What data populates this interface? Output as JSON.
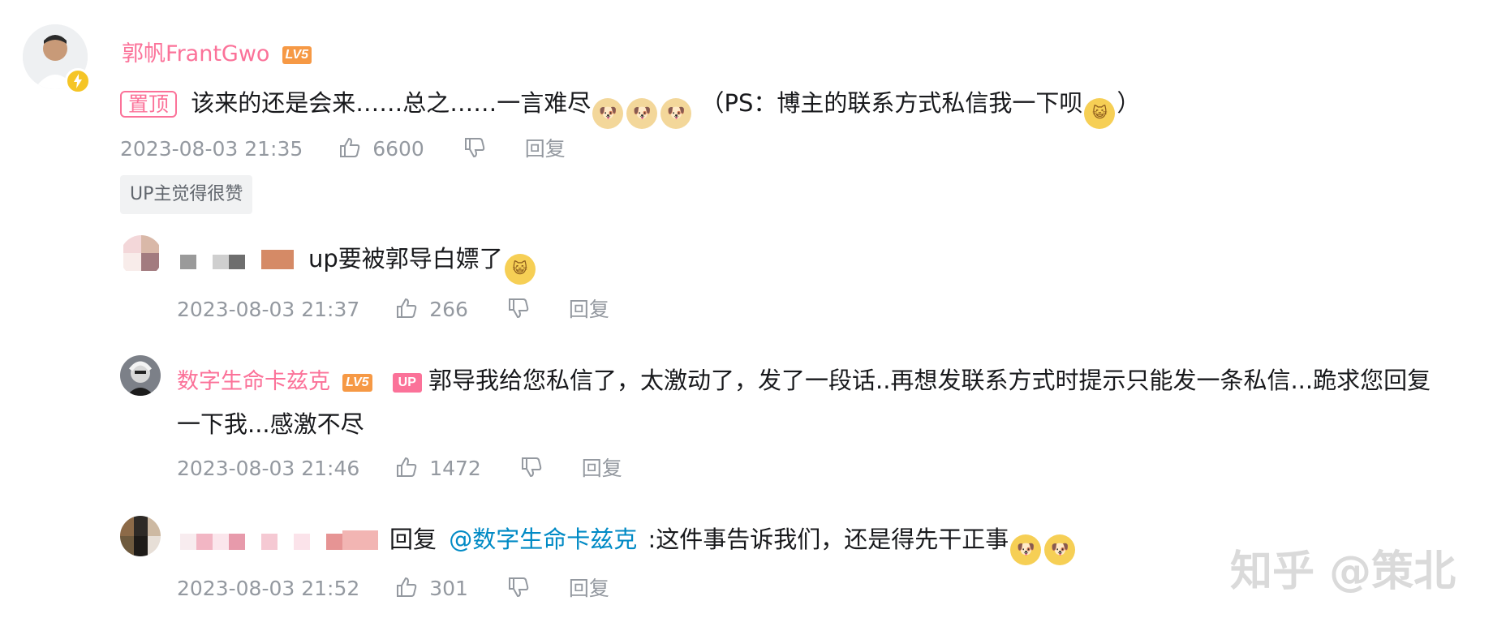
{
  "comments": [
    {
      "username": "郭帆FrantGwo",
      "level": "LV5",
      "pinned_label": "置顶",
      "text_before": "该来的还是会来……总之……一言难尽",
      "text_after": "（PS：博主的联系方式私信我一下呗",
      "text_end": "）",
      "time": "2023-08-03 21:35",
      "likes": "6600",
      "reply_label": "回复",
      "up_liked_label": "UP主觉得很赞"
    }
  ],
  "replies": [
    {
      "username": "",
      "text": "up要被郭导白嫖了",
      "time": "2023-08-03 21:37",
      "likes": "266",
      "reply_label": "回复"
    },
    {
      "username": "数字生命卡兹克",
      "level": "LV5",
      "up_badge": "UP",
      "text_line1": "郭导我给您私信了，太激动了，发了一段话..再想发联系方式时提示只能发一条私信...跪求您回复",
      "text_line2": "一下我...感激不尽",
      "time": "2023-08-03 21:46",
      "likes": "1472",
      "reply_label": "回复"
    },
    {
      "username": "",
      "reply_prefix": "回复",
      "mention": "@数字生命卡兹克",
      "text": ":这件事告诉我们，还是得先干正事",
      "time": "2023-08-03 21:52",
      "likes": "301",
      "reply_label": "回复"
    }
  ],
  "watermark": "知乎 @策北",
  "colors": {
    "username": "#fb7299",
    "meta": "#9499a0",
    "mention": "#008ac5",
    "level_badge": "#f69945"
  },
  "icons": [
    "like-icon",
    "dislike-icon",
    "lightning-icon",
    "emoji-dog",
    "emoji-cat"
  ]
}
